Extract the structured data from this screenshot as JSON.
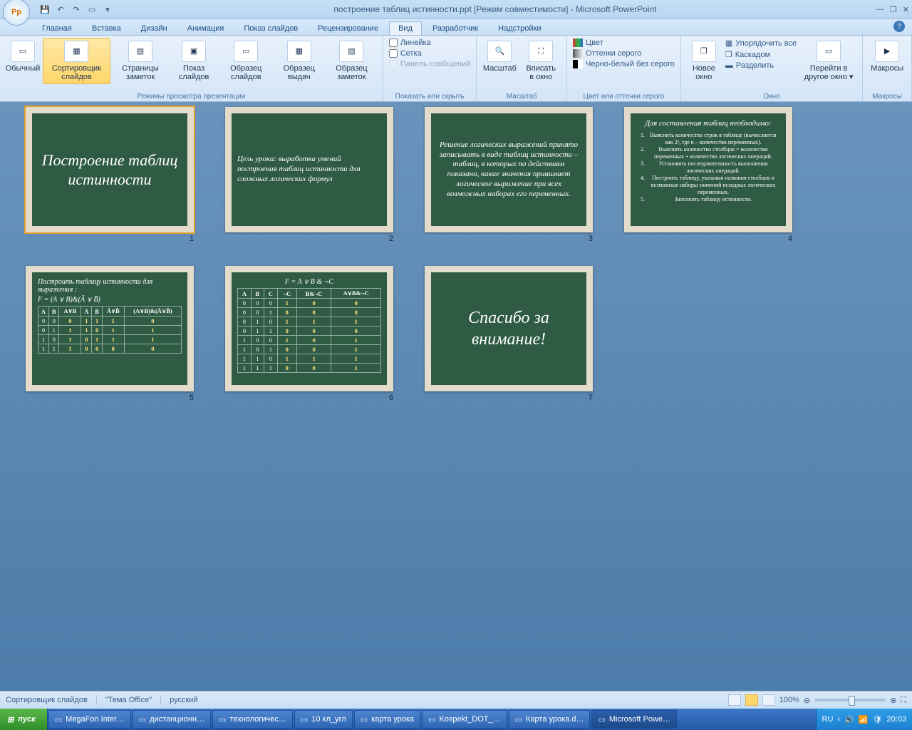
{
  "title": "построение таблиц истинности.ppt [Режим совместимости] - Microsoft PowerPoint",
  "tabs": [
    "Главная",
    "Вставка",
    "Дизайн",
    "Анимация",
    "Показ слайдов",
    "Рецензирование",
    "Вид",
    "Разработчик",
    "Надстройки"
  ],
  "active_tab": 6,
  "office_logo": "Pp",
  "ribbon": {
    "g1": {
      "label": "Режимы просмотра презентации",
      "btns": [
        "Обычный",
        "Сортировщик слайдов",
        "Страницы заметок",
        "Показ слайдов",
        "Образец слайдов",
        "Образец выдач",
        "Образец заметок"
      ],
      "selected": 1
    },
    "g2": {
      "label": "Показать или скрыть",
      "opts": [
        "Линейка",
        "Сетка",
        "Панель сообщений"
      ]
    },
    "g3": {
      "label": "Масштаб",
      "btns": [
        "Масштаб",
        "Вписать в окно"
      ]
    },
    "g4": {
      "label": "Цвет или оттенки серого",
      "opts": [
        "Цвет",
        "Оттенки серого",
        "Черно-белый без серого"
      ]
    },
    "g5": {
      "label": "Окно",
      "btn": "Новое окно",
      "opts": [
        "Упорядочить все",
        "Каскадом",
        "Разделить"
      ],
      "btn2": "Перейти в другое окно ▾"
    },
    "g6": {
      "label": "Макросы",
      "btn": "Макросы"
    }
  },
  "slides": {
    "s1": "Построение таблиц истинности",
    "s2": "Цель урока: выработка умений построения таблиц истинности для сложных логических формул",
    "s3": "Решение логических выражений принято записывать в виде таблиц истинности – таблиц, в которых по действиям показано, какие значения принимает логическое выражение при всех возможных наборах его переменных.",
    "s4_h": "Для составления таблиц необходимо:",
    "s4_items": [
      "Выяснить количество строк в таблице (вычисляется как 2ⁿ, где n – количество переменных).",
      "Выяснить количество столбцов = количество переменных + количество логических операций.",
      "Установить последовательность выполнения логических операций.",
      "Построить таблицу, указывая названия столбцов и возможные наборы значений исходных логических переменных.",
      "Заполнить таблицу истинности."
    ],
    "s5_h1": "Построить таблицу истинности для выражения :",
    "s5_h2": "F = (A ∨ B)&(Ā ∨ B̄)",
    "s5_cols": [
      "A",
      "B",
      "A∨B",
      "Ā",
      "B̄",
      "Ā∨B̄",
      "(A∨B)&(Ā∨B̄)"
    ],
    "s5_rows": [
      [
        "0",
        "0",
        "0",
        "1",
        "1",
        "1",
        "0"
      ],
      [
        "0",
        "1",
        "1",
        "1",
        "0",
        "1",
        "1"
      ],
      [
        "1",
        "0",
        "1",
        "0",
        "1",
        "1",
        "1"
      ],
      [
        "1",
        "1",
        "1",
        "0",
        "0",
        "0",
        "0"
      ]
    ],
    "s6_h": "F = A ∨ B & ¬C",
    "s6_cols": [
      "A",
      "B",
      "C",
      "¬C",
      "B&¬C",
      "A∨B&¬C"
    ],
    "s6_rows": [
      [
        "0",
        "0",
        "0",
        "1",
        "0",
        "0"
      ],
      [
        "0",
        "0",
        "1",
        "0",
        "0",
        "0"
      ],
      [
        "0",
        "1",
        "0",
        "1",
        "1",
        "1"
      ],
      [
        "0",
        "1",
        "1",
        "0",
        "0",
        "0"
      ],
      [
        "1",
        "0",
        "0",
        "1",
        "0",
        "1"
      ],
      [
        "1",
        "0",
        "1",
        "0",
        "0",
        "1"
      ],
      [
        "1",
        "1",
        "0",
        "1",
        "1",
        "1"
      ],
      [
        "1",
        "1",
        "1",
        "0",
        "0",
        "1"
      ]
    ],
    "s7": "Спасибо за внимание!"
  },
  "status": {
    "mode": "Сортировщик слайдов",
    "theme": "\"Тема Office\"",
    "lang": "русский",
    "zoom": "100%"
  },
  "taskbar": {
    "start": "пуск",
    "items": [
      "MegaFon Inter…",
      "дистанционн…",
      "технологичес…",
      "10 кл_угл",
      "карта урока",
      "Kospekt_DOT_…",
      "Карта урока.d…",
      "Microsoft Powe…"
    ],
    "active": 7,
    "kbd": "RU",
    "time": "20:03"
  }
}
